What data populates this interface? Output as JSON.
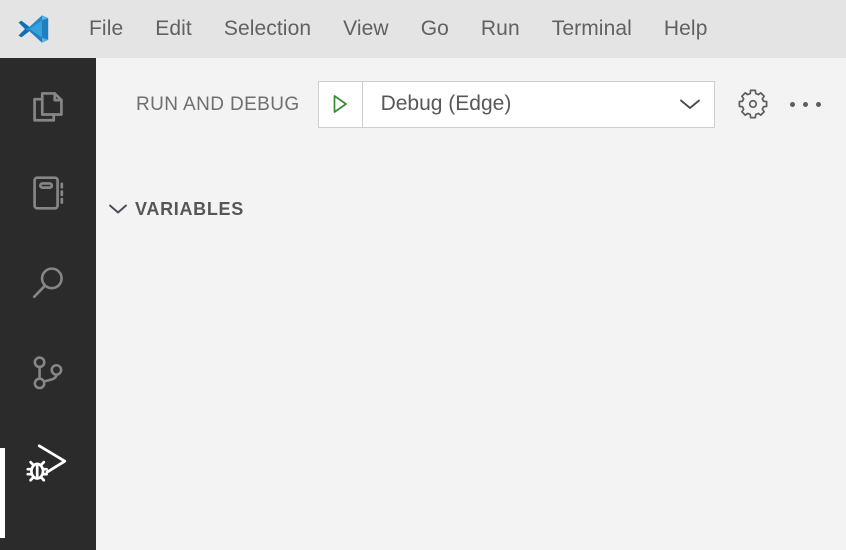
{
  "window": {
    "titlebar_bg": "#e4e4e4",
    "panel_bg": "#f3f3f3",
    "activitybar_bg": "#2b2b2b"
  },
  "titlebar": {
    "logo_name": "vscode-logo",
    "menu": [
      {
        "label": "File",
        "name": "menu-item-file"
      },
      {
        "label": "Edit",
        "name": "menu-item-edit"
      },
      {
        "label": "Selection",
        "name": "menu-item-selection"
      },
      {
        "label": "View",
        "name": "menu-item-view"
      },
      {
        "label": "Go",
        "name": "menu-item-go"
      },
      {
        "label": "Run",
        "name": "menu-item-run"
      },
      {
        "label": "Terminal",
        "name": "menu-item-terminal"
      },
      {
        "label": "Help",
        "name": "menu-item-help"
      }
    ]
  },
  "activitybar": {
    "active_indicator_color": "#ffffff",
    "inactive_icon_color": "#868686",
    "active_icon_color": "#ffffff",
    "items": [
      {
        "icon": "files-explorer-icon",
        "title": "Explorer",
        "active": false
      },
      {
        "icon": "notebook-icon",
        "title": "Open Editors",
        "active": false
      },
      {
        "icon": "search-icon",
        "title": "Search",
        "active": false
      },
      {
        "icon": "source-control-icon",
        "title": "Source Control",
        "active": false
      },
      {
        "icon": "run-and-debug-icon",
        "title": "Run and Debug",
        "active": true
      }
    ]
  },
  "debug_panel": {
    "title": "RUN AND DEBUG",
    "configuration": {
      "selected": "Debug (Edge)",
      "start_icon": "play-triangle-icon",
      "start_icon_color": "#388a34",
      "dropdown_icon": "chevron-down-icon",
      "border_color": "#cecece",
      "background": "#ffffff"
    },
    "actions": [
      {
        "label": "",
        "icon": "gear-icon",
        "name": "open-launch-settings-button"
      },
      {
        "label": "",
        "icon": "ellipsis-icon",
        "name": "views-and-more-actions-button"
      }
    ],
    "sections": [
      {
        "label": "VARIABLES",
        "expanded": true,
        "chevron_icon": "chevron-down-icon",
        "items": []
      }
    ]
  }
}
